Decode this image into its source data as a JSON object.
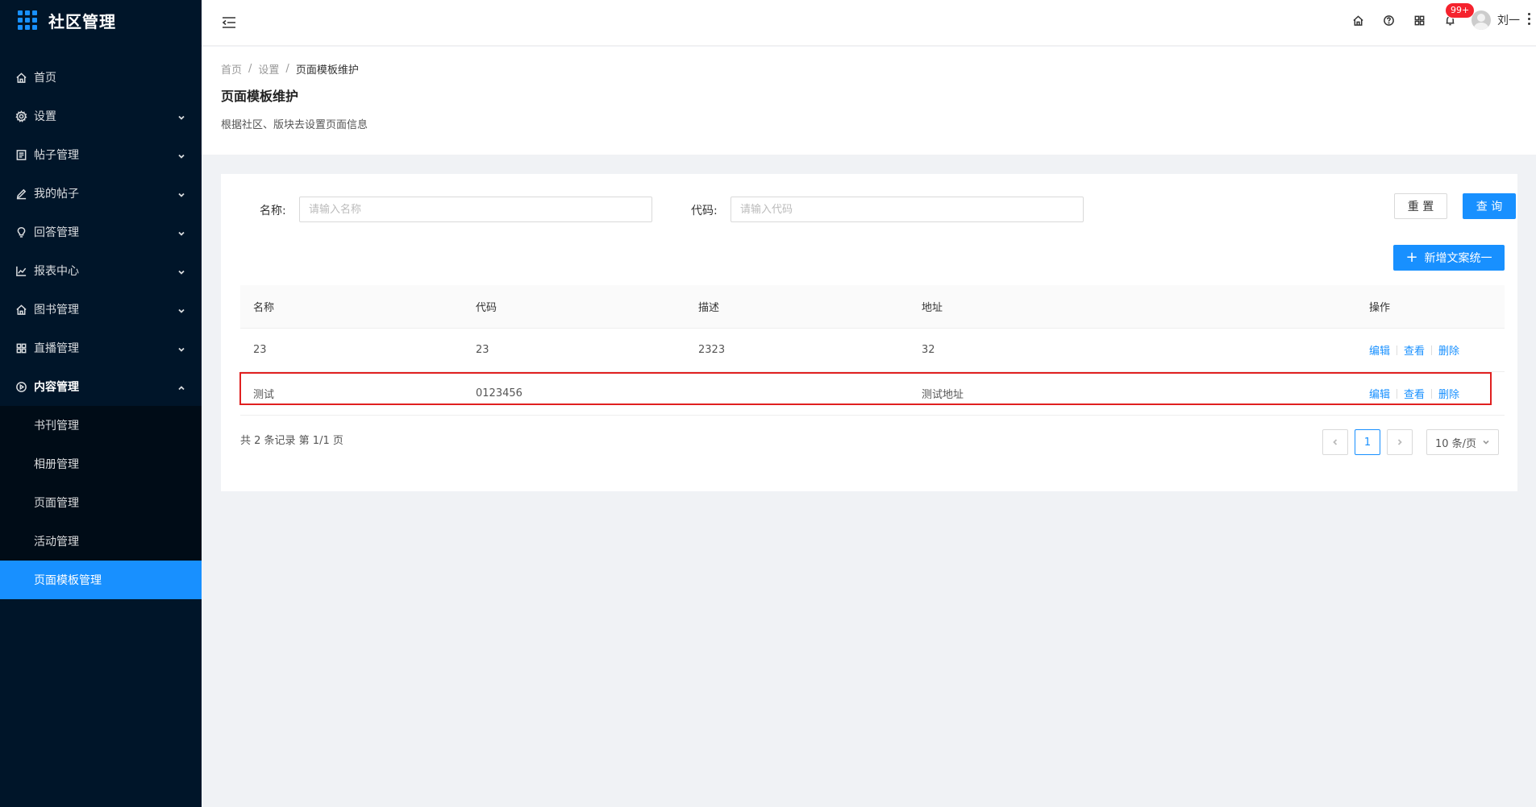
{
  "app": {
    "title": "社区管理"
  },
  "sidebar": {
    "items": [
      {
        "label": "首页",
        "icon": "home-icon"
      },
      {
        "label": "设置",
        "icon": "gear-icon"
      },
      {
        "label": "帖子管理",
        "icon": "document-icon"
      },
      {
        "label": "我的帖子",
        "icon": "pen-icon"
      },
      {
        "label": "回答管理",
        "icon": "bulb-icon"
      },
      {
        "label": "报表中心",
        "icon": "chart-icon"
      },
      {
        "label": "图书管理",
        "icon": "home-icon"
      },
      {
        "label": "直播管理",
        "icon": "grid-icon"
      },
      {
        "label": "内容管理",
        "icon": "play-circle-icon"
      }
    ],
    "submenu": [
      "书刊管理",
      "相册管理",
      "页面管理",
      "活动管理",
      "页面模板管理"
    ]
  },
  "header": {
    "notification_count": "99+",
    "user_name": "刘一"
  },
  "breadcrumb": {
    "home": "首页",
    "settings": "设置",
    "current": "页面模板维护"
  },
  "page": {
    "title": "页面模板维护",
    "description": "根据社区、版块去设置页面信息"
  },
  "search": {
    "name_label": "名称:",
    "name_placeholder": "请输入名称",
    "code_label": "代码:",
    "code_placeholder": "请输入代码",
    "reset": "重 置",
    "query": "查 询",
    "add": "新增文案统一"
  },
  "table": {
    "headers": [
      "名称",
      "代码",
      "描述",
      "地址",
      "操作"
    ],
    "rows": [
      {
        "name": "23",
        "code": "23",
        "desc": "2323",
        "address": "32"
      },
      {
        "name": "测试",
        "code": "0123456",
        "desc": "",
        "address": "测试地址"
      }
    ],
    "actions": {
      "edit": "编辑",
      "view": "查看",
      "delete": "删除"
    }
  },
  "pagination": {
    "total": "共 2 条记录 第 1/1 页",
    "current": "1",
    "page_size": "10 条/页"
  }
}
